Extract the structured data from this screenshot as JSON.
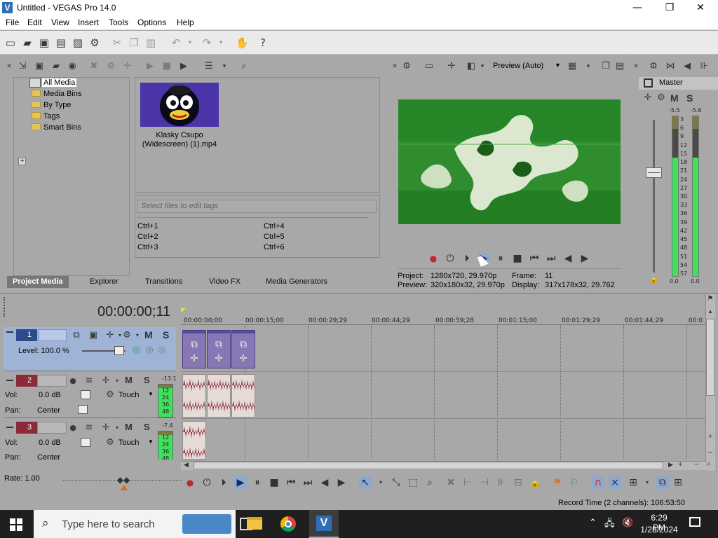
{
  "window": {
    "title": "Untitled - VEGAS Pro 14.0",
    "controls": [
      "—",
      "❐",
      "✕"
    ]
  },
  "menu": [
    "File",
    "Edit",
    "View",
    "Insert",
    "Tools",
    "Options",
    "Help"
  ],
  "media_panel": {
    "tree": [
      {
        "label": "All Media",
        "selected": true
      },
      {
        "label": "Media Bins"
      },
      {
        "label": "By Type",
        "expander": "+"
      },
      {
        "label": "Tags"
      },
      {
        "label": "Smart Bins"
      }
    ],
    "media_item": {
      "line1": "Klasky Csupo",
      "line2": "(Widescreen) (1).mp4"
    },
    "tag_placeholder": "Select files to edit tags",
    "shortcuts_left": [
      "Ctrl+1",
      "Ctrl+2",
      "Ctrl+3"
    ],
    "shortcuts_right": [
      "Ctrl+4",
      "Ctrl+5",
      "Ctrl+6"
    ],
    "tabs": [
      "Project Media",
      "Explorer",
      "Transitions",
      "Video FX",
      "Media Generators"
    ]
  },
  "preview": {
    "mode": "Preview (Auto)",
    "project_label": "Project:",
    "project_value": "1280x720, 29.970p",
    "preview_label": "Preview:",
    "preview_value": "320x180x32, 29.970p",
    "frame_label": "Frame:",
    "frame_value": "11",
    "display_label": "Display:",
    "display_value": "317x178x32, 29.762"
  },
  "master": {
    "title": "Master",
    "m": "M",
    "s": "S",
    "left_peak": "-5.5",
    "right_peak": "-5.6",
    "scale": [
      "3",
      "6",
      "9",
      "12",
      "15",
      "18",
      "21",
      "24",
      "27",
      "30",
      "33",
      "36",
      "39",
      "42",
      "45",
      "48",
      "51",
      "54",
      "57"
    ],
    "left_level": "0.0",
    "right_level": "0.0",
    "left_fill": 0.74,
    "right_fill": 0.74
  },
  "timeline": {
    "timecode": "00:00:00;11",
    "ruler": [
      "00:00:00;00",
      "00:00:15;00",
      "00:00:29;29",
      "00:00:44;29",
      "00:00:59;28",
      "00:01:15;00",
      "00:01:29;29",
      "00:01:44;29",
      "00:0"
    ],
    "tracks": [
      {
        "num": "1",
        "m": "M",
        "s": "S",
        "level": "Level: 100.0 %"
      },
      {
        "num": "2",
        "m": "M",
        "s": "S",
        "vol_label": "Vol:",
        "vol": "0.0 dB",
        "pan_label": "Pan:",
        "pan": "Center",
        "mode": "Touch",
        "meter_top": "-13.1",
        "meter_scale": [
          "12",
          "24",
          "36",
          "48"
        ]
      },
      {
        "num": "3",
        "m": "M",
        "s": "S",
        "vol_label": "Vol:",
        "vol": "0.0 dB",
        "pan_label": "Pan:",
        "pan": "Center",
        "mode": "Touch",
        "meter_top": "-7.4",
        "meter_scale": [
          "12",
          "24",
          "36",
          "48"
        ]
      }
    ],
    "rate": "Rate: 1.00",
    "record_time": "Record Time (2 channels): 106:53:50"
  },
  "taskbar": {
    "search_placeholder": "Type here to search",
    "time": "6:29 PM",
    "date": "1/28/2024"
  },
  "colors": {
    "track1": "#9eb3d6",
    "track_num": "#2d4a8c",
    "audio_num": "#8b2b3a",
    "meter_green": "#3ee25c",
    "video_clip": "#8777b4"
  }
}
